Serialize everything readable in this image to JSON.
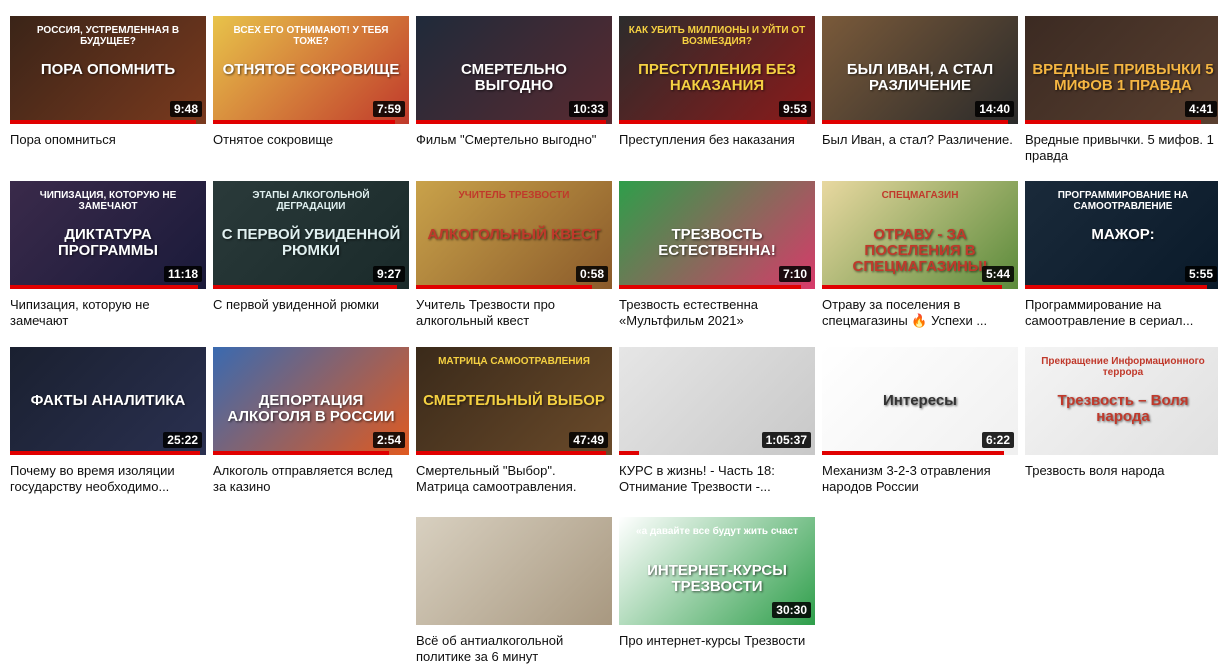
{
  "videos": [
    {
      "title": "Пора опомниться",
      "duration": "9:48",
      "thumb_text": "ПОРА ОПОМНИТЬ",
      "thumb_subtext": "РОССИЯ, УСТРЕМЛЕННАЯ В БУДУЩЕЕ?",
      "bg": "#3a2418",
      "bg2": "#7a3a1e",
      "text_color": "#ffffff",
      "progress": 0.95
    },
    {
      "title": "Отнятое сокровище",
      "duration": "7:59",
      "thumb_text": "ОТНЯТОЕ СОКРОВИЩЕ",
      "thumb_subtext": "ВСЕХ ЕГО ОТНИМАЮТ! У ТЕБЯ ТОЖЕ?",
      "bg": "#e8c34a",
      "bg2": "#c0392b",
      "text_color": "#ffffff",
      "progress": 0.93
    },
    {
      "title": "Фильм \"Смертельно выгодно\"",
      "duration": "10:33",
      "thumb_text": "СМЕРТЕЛЬНО ВЫГОДНО",
      "thumb_subtext": "",
      "bg": "#1f2a3a",
      "bg2": "#5a2a30",
      "text_color": "#ffffff",
      "progress": 0.97
    },
    {
      "title": "Преступления без наказания",
      "duration": "9:53",
      "thumb_text": "ПРЕСТУПЛЕНИЯ БЕЗ НАКАЗАНИЯ",
      "thumb_subtext": "КАК УБИТЬ МИЛЛИОНЫ И УЙТИ ОТ ВОЗМЕЗДИЯ?",
      "bg": "#2c2c2c",
      "bg2": "#8b1a1a",
      "text_color": "#f5d142",
      "progress": 0.96
    },
    {
      "title": "Был Иван, а стал? Различение.",
      "duration": "14:40",
      "thumb_text": "БЫЛ ИВАН, А СТАЛ РАЗЛИЧЕНИЕ",
      "thumb_subtext": "",
      "bg": "#7a5a3a",
      "bg2": "#2a2a2a",
      "text_color": "#ffffff",
      "progress": 0.95
    },
    {
      "title": "Вредные привычки. 5 мифов. 1 правда",
      "duration": "4:41",
      "thumb_text": "ВРЕДНЫЕ ПРИВЫЧКИ 5 МИФОВ 1 ПРАВДА",
      "thumb_subtext": "",
      "bg": "#3b2a22",
      "bg2": "#5a4030",
      "text_color": "#f5b642",
      "progress": 0.9
    },
    {
      "title": "Чипизация, которую не замечают",
      "duration": "11:18",
      "thumb_text": "ДИКТАТУРА ПРОГРАММЫ",
      "thumb_subtext": "ЧИПИЗАЦИЯ, КОТОРУЮ НЕ ЗАМЕЧАЮТ",
      "bg": "#3a2a4a",
      "bg2": "#1a1a3a",
      "text_color": "#ffffff",
      "progress": 0.96
    },
    {
      "title": "С первой увиденной рюмки",
      "duration": "9:27",
      "thumb_text": "С ПЕРВОЙ УВИДЕННОЙ РЮМКИ",
      "thumb_subtext": "ЭТАПЫ АЛКОГОЛЬНОЙ ДЕГРАДАЦИИ",
      "bg": "#2a3a3a",
      "bg2": "#1a2a2a",
      "text_color": "#e0f0f0",
      "progress": 0.94
    },
    {
      "title": "Учитель Трезвости про алкогольный квест",
      "duration": "0:58",
      "thumb_text": "АЛКОГОЛЬНЫЙ КВЕСТ",
      "thumb_subtext": "УЧИТЕЛЬ ТРЕЗВОСТИ",
      "bg": "#c9a24a",
      "bg2": "#8a5a2a",
      "text_color": "#c0392b",
      "progress": 0.9
    },
    {
      "title": "Трезвость естественна «Мультфильм 2021»",
      "duration": "7:10",
      "thumb_text": "ТРЕЗВОСТЬ ЕСТЕСТВЕННА!",
      "thumb_subtext": "",
      "bg": "#2e9e4a",
      "bg2": "#d83a6a",
      "text_color": "#ffffff",
      "progress": 0.93
    },
    {
      "title": "Отраву за поселения в спецмагазины 🔥 Успехи ...",
      "duration": "5:44",
      "thumb_text": "ОТРАВУ - ЗА ПОСЕЛЕНИЯ В СПЕЦМАГАЗИНЫ!",
      "thumb_subtext": "СПЕЦМАГАЗИН",
      "bg": "#e8d8a0",
      "bg2": "#5a8a3a",
      "text_color": "#c0392b",
      "progress": 0.92
    },
    {
      "title": "Программирование на самоотравление в сериал...",
      "duration": "5:55",
      "thumb_text": "МАЖОР:",
      "thumb_subtext": "ПРОГРАММИРОВАНИЕ НА САМООТРАВЛЕНИЕ",
      "bg": "#1a2a3a",
      "bg2": "#0a1a2a",
      "text_color": "#ffffff",
      "progress": 0.93
    },
    {
      "title": "Почему во время изоляции государству необходимо...",
      "duration": "25:22",
      "thumb_text": "ФАКТЫ АНАЛИТИКА",
      "thumb_subtext": "",
      "bg": "#1a2030",
      "bg2": "#2a3050",
      "text_color": "#ffffff",
      "progress": 0.97
    },
    {
      "title": "Алкоголь отправляется вслед за казино",
      "duration": "2:54",
      "thumb_text": "ДЕПОРТАЦИЯ АЛКОГОЛЯ В РОССИИ",
      "thumb_subtext": "",
      "bg": "#3a6ab0",
      "bg2": "#e05a20",
      "text_color": "#ffffff",
      "progress": 0.9
    },
    {
      "title": "Смертельный \"Выбор\". Матрица самоотравления.",
      "duration": "47:49",
      "thumb_text": "СМЕРТЕЛЬНЫЙ ВЫБОР",
      "thumb_subtext": "МАТРИЦА САМООТРАВЛЕНИЯ",
      "bg": "#3a2a1a",
      "bg2": "#6a4a2a",
      "text_color": "#f5d142",
      "progress": 0.97
    },
    {
      "title": "КУРС в жизнь! - Часть 18: Отнимание Трезвости -...",
      "duration": "1:05:37",
      "thumb_text": "",
      "thumb_subtext": "",
      "bg": "#e6e6e6",
      "bg2": "#c8c8c8",
      "text_color": "#333333",
      "progress": 0.1
    },
    {
      "title": "Механизм 3-2-3 отравления народов России",
      "duration": "6:22",
      "thumb_text": "Интересы",
      "thumb_subtext": "",
      "bg": "#ffffff",
      "bg2": "#f0f0f0",
      "text_color": "#333333",
      "progress": 0.93
    },
    {
      "title": "Трезвость воля народа",
      "duration": "",
      "thumb_text": "Трезвость – Воля народа",
      "thumb_subtext": "Прекращение Информационного террора",
      "bg": "#f4f4f4",
      "bg2": "#e0e0e0",
      "text_color": "#c0392b",
      "progress": 0.0
    },
    {
      "title": "Всё об антиалкогольной политике за 6 минут",
      "duration": "",
      "thumb_text": "",
      "thumb_subtext": "",
      "bg": "#d8d0c0",
      "bg2": "#a89880",
      "text_color": "#333333",
      "progress": 0.0
    },
    {
      "title": "Про интернет-курсы Трезвости",
      "duration": "30:30",
      "thumb_text": "ИНТЕРНЕТ-КУРСЫ ТРЕЗВОСТИ",
      "thumb_subtext": "«а давайте все будут жить счаст",
      "bg": "#ffffff",
      "bg2": "#2e9e4a",
      "text_color": "#ffffff",
      "progress": 0.0
    }
  ]
}
